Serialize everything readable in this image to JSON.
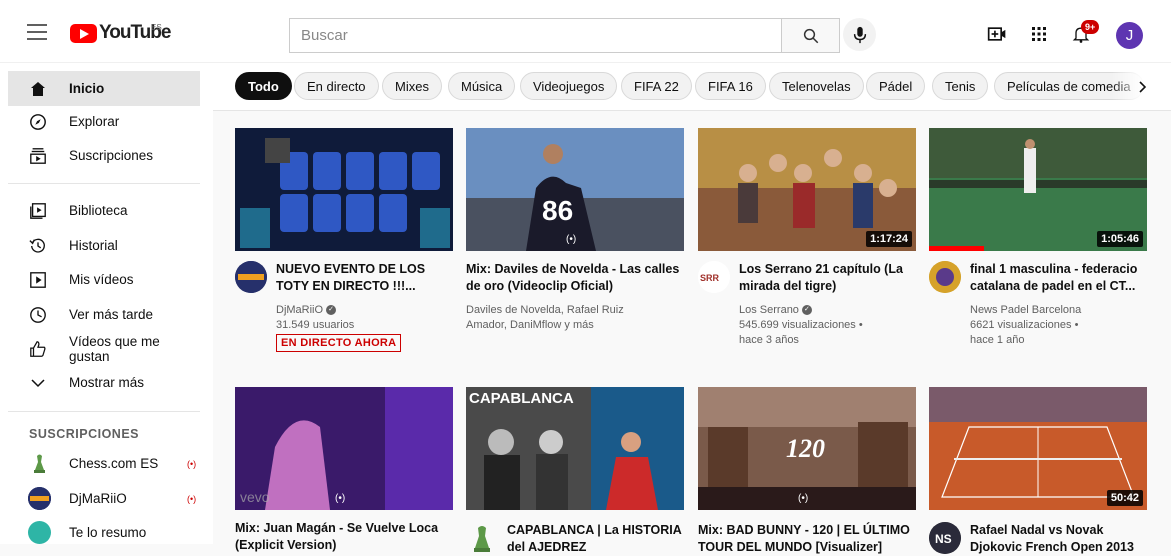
{
  "masthead": {
    "logo_text": "YouTube",
    "country": "ES",
    "search_placeholder": "Buscar",
    "notifications_badge": "9+",
    "avatar_letter": "J"
  },
  "sidebar": {
    "main": [
      {
        "label": "Inicio",
        "icon": "home-icon",
        "active": true
      },
      {
        "label": "Explorar",
        "icon": "compass-icon"
      },
      {
        "label": "Suscripciones",
        "icon": "subscriptions-icon"
      }
    ],
    "library": [
      {
        "label": "Biblioteca",
        "icon": "library-icon"
      },
      {
        "label": "Historial",
        "icon": "history-icon"
      },
      {
        "label": "Mis vídeos",
        "icon": "my-videos-icon"
      },
      {
        "label": "Ver más tarde",
        "icon": "clock-icon"
      },
      {
        "label": "Vídeos que me gustan",
        "icon": "thumbs-up-icon"
      },
      {
        "label": "Mostrar más",
        "icon": "chevron-down-icon"
      }
    ],
    "subscriptions_title": "SUSCRIPCIONES",
    "subscriptions": [
      {
        "label": "Chess.com ES",
        "live": "(•)"
      },
      {
        "label": "DjMaRiiO",
        "live": "(•)"
      },
      {
        "label": "Te lo resumo",
        "live": ""
      }
    ]
  },
  "chips": [
    "Todo",
    "En directo",
    "Mixes",
    "Música",
    "Videojuegos",
    "FIFA 22",
    "FIFA 16",
    "Telenovelas",
    "Pádel",
    "Tenis",
    "Películas de comedia"
  ],
  "videos_row1": [
    {
      "title": "NUEVO EVENTO DE LOS TOTY EN DIRECTO !!!...",
      "channel": "DjMaRiiO",
      "verified": true,
      "meta1": "31.549 usuarios",
      "live_badge": "EN DIRECTO AHORA",
      "duration": ""
    },
    {
      "title": "Mix: Daviles de Novelda - Las calles de oro (Videoclip Oficial)",
      "channel": "Daviles de Novelda, Rafael Ruiz Amador, DaniMflow y más",
      "duration": "(•)"
    },
    {
      "title": "Los Serrano 21 capítulo (La mirada del tigre)",
      "channel": "Los Serrano",
      "verified": true,
      "meta1": "545.699 visualizaciones •",
      "meta2": "hace 3 años",
      "duration": "1:17:24"
    },
    {
      "title": "final 1 masculina - federacio catalana de padel en el CT...",
      "channel": "News Padel Barcelona",
      "meta1": "6621 visualizaciones •",
      "meta2": "hace 1 año",
      "duration": "1:05:46"
    }
  ],
  "videos_row2": [
    {
      "title": "Mix: Juan Magán - Se Vuelve Loca (Explicit Version)",
      "duration": "(•)"
    },
    {
      "title": "CAPABLANCA | La HISTORIA del AJEDREZ",
      "thumb_text": "CAPABLANCA"
    },
    {
      "title": "Mix: BAD BUNNY - 120 | EL ÚLTIMO TOUR DEL MUNDO [Visualizer]",
      "thumb_text": "120",
      "duration": "(•)"
    },
    {
      "title": "Rafael Nadal vs Novak Djokovic French Open 2013",
      "duration": "50:42"
    }
  ],
  "colors": {
    "accent": "#ff0000",
    "live": "#cc0000",
    "chip_active": "#0f0f0f"
  }
}
